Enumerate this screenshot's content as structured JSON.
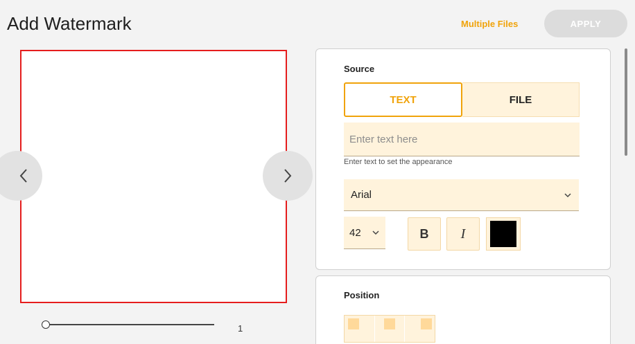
{
  "header": {
    "title": "Add Watermark",
    "multiple_files_label": "Multiple Files",
    "apply_label": "APPLY"
  },
  "preview": {
    "page_number": "1",
    "zoom_fraction": 0
  },
  "source": {
    "label": "Source",
    "tabs": [
      {
        "label": "TEXT",
        "selected": true
      },
      {
        "label": "FILE",
        "selected": false
      }
    ],
    "text_value": "",
    "text_placeholder": "Enter text here",
    "helper": "Enter text to set the appearance",
    "font": "Arial",
    "size": "42",
    "bold_label": "B",
    "italic_label": "I",
    "color": "#000000"
  },
  "position": {
    "label": "Position"
  },
  "colors": {
    "accent": "#f0a30a",
    "input_bg": "#fff3dc",
    "preview_border": "#e51c1c"
  }
}
